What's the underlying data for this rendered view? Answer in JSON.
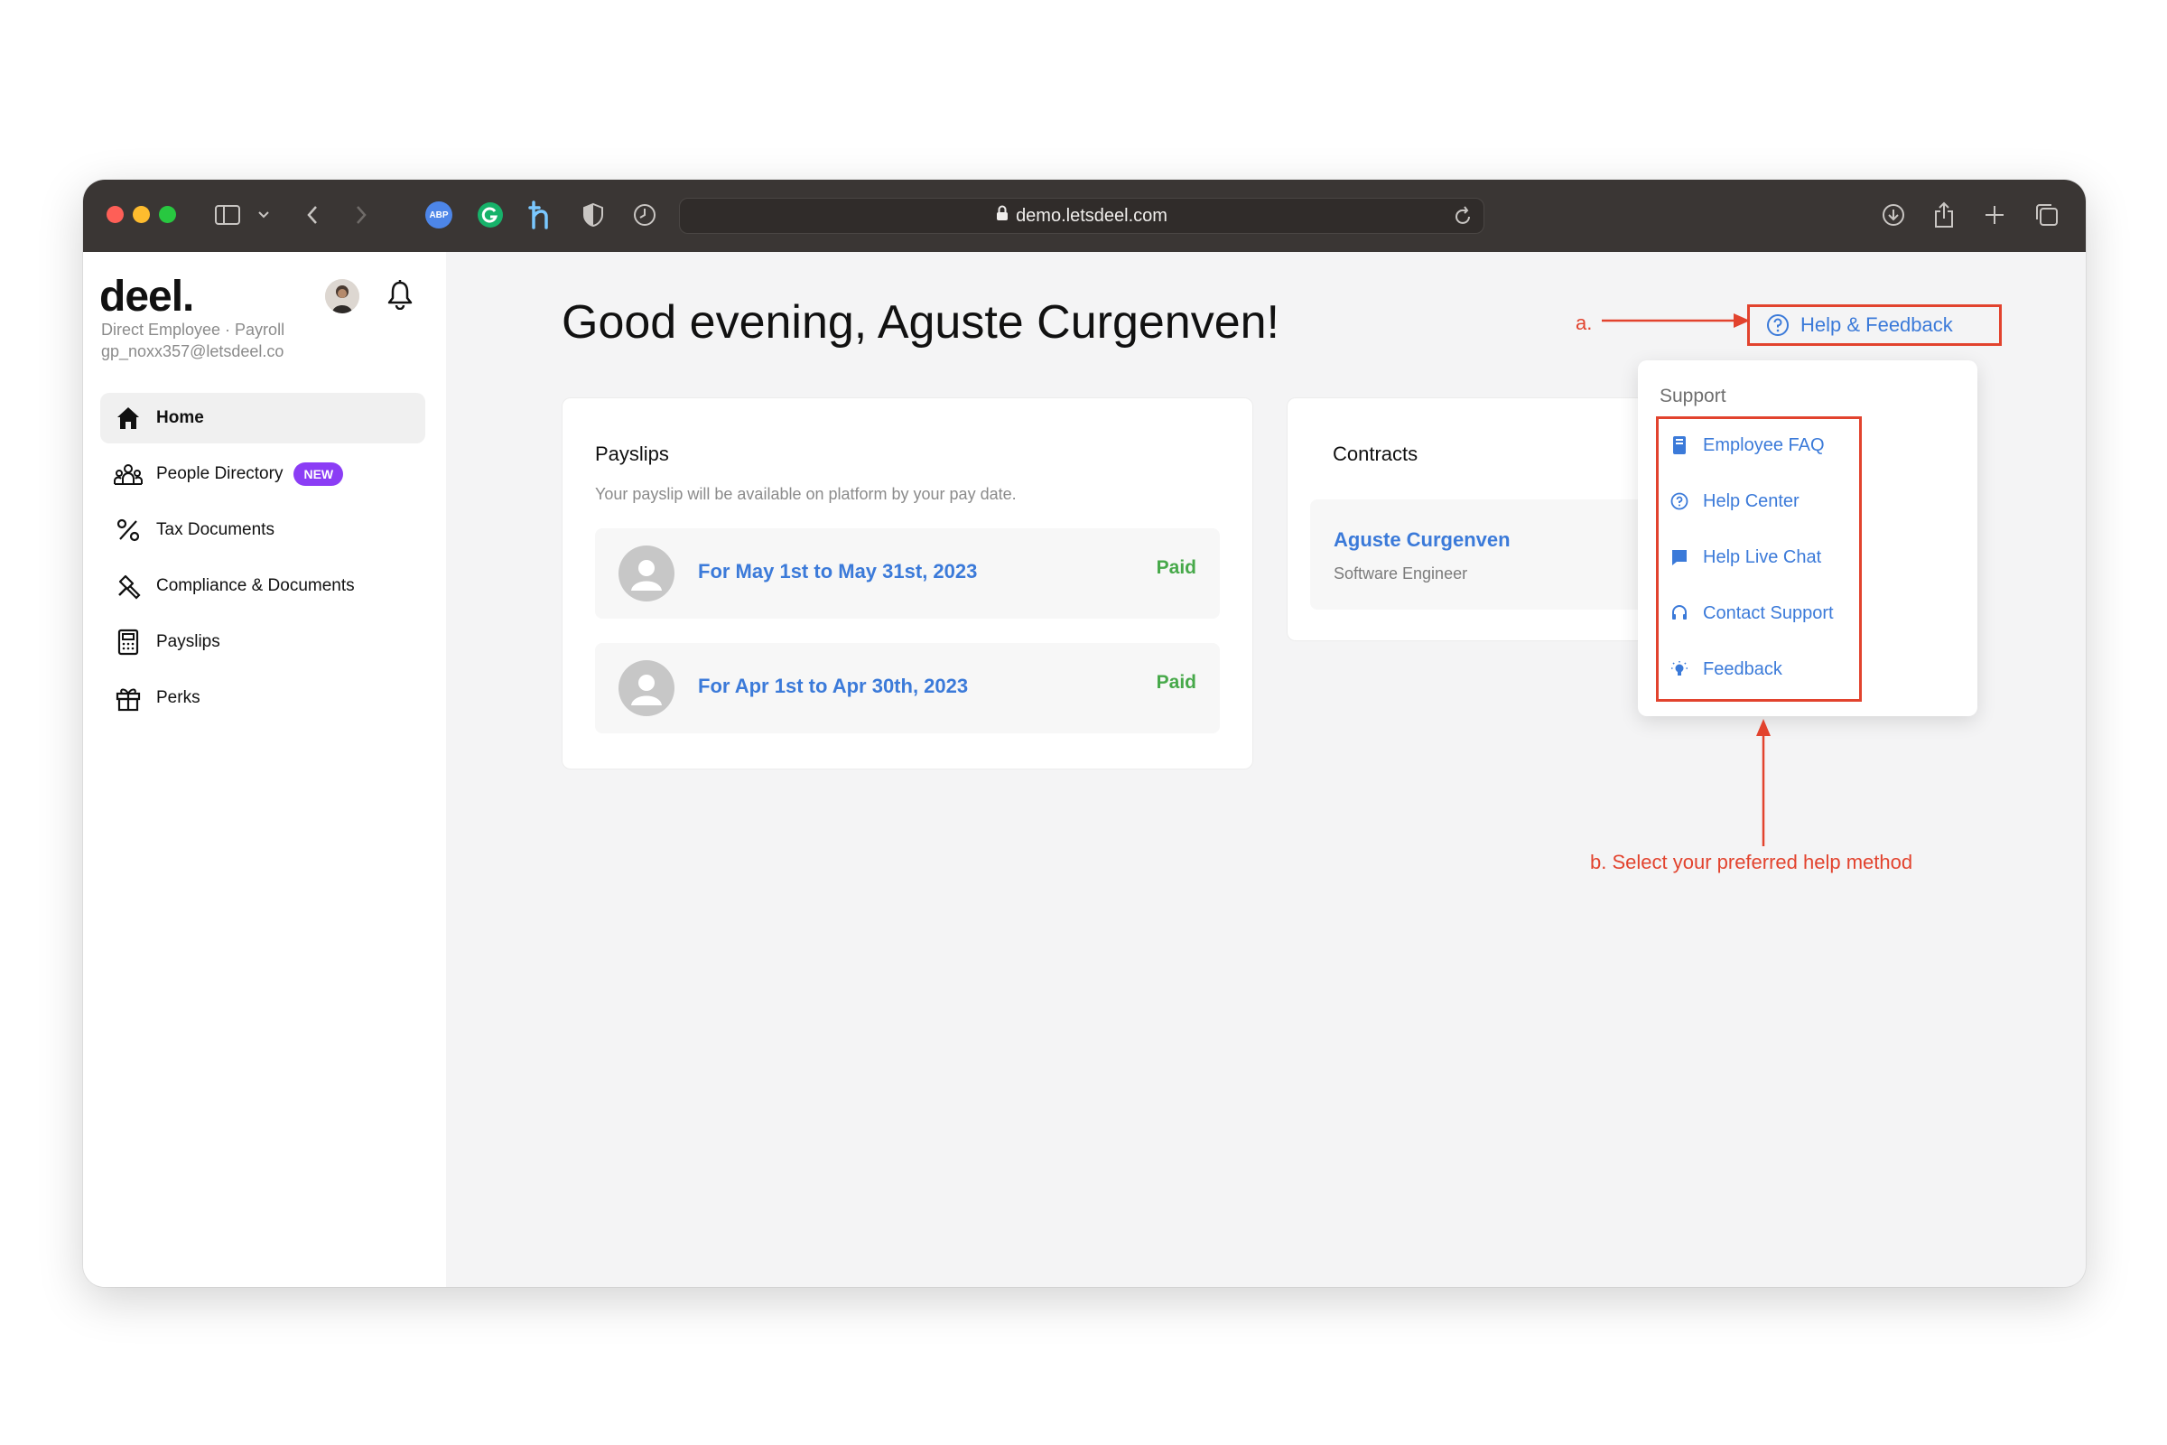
{
  "browser": {
    "url": "demo.letsdeel.com",
    "icons": [
      "sidebar-toggle-icon",
      "chevron-down-icon",
      "back-icon",
      "forward-icon",
      "abp-extension-icon",
      "grammarly-icon",
      "honey-icon",
      "privacy-shield-icon",
      "history-icon",
      "lock-icon",
      "reload-icon",
      "download-icon",
      "share-icon",
      "new-tab-icon",
      "tabs-overview-icon"
    ],
    "abp_label": "ABP"
  },
  "sidebar": {
    "logo": "deel.",
    "user_line_1": "Direct Employee · Payroll",
    "user_line_2": "gp_noxx357@letsdeel.co",
    "items": [
      {
        "label": "Home",
        "icon": "home-icon",
        "active": true
      },
      {
        "label": "People Directory",
        "icon": "people-icon",
        "badge": "NEW"
      },
      {
        "label": "Tax Documents",
        "icon": "percent-icon"
      },
      {
        "label": "Compliance & Documents",
        "icon": "gavel-icon"
      },
      {
        "label": "Payslips",
        "icon": "payslip-icon"
      },
      {
        "label": "Perks",
        "icon": "gift-icon"
      }
    ]
  },
  "main": {
    "greeting": "Good evening, Aguste Curgenven!",
    "payslips": {
      "title": "Payslips",
      "subtitle": "Your payslip will be available on platform by your pay date.",
      "rows": [
        {
          "period": "For May 1st to May 31st, 2023",
          "status": "Paid"
        },
        {
          "period": "For Apr 1st to Apr 30th, 2023",
          "status": "Paid"
        }
      ]
    },
    "contracts": {
      "title": "Contracts",
      "name": "Aguste Curgenven",
      "role": "Software Engineer"
    }
  },
  "help": {
    "button_label": "Help & Feedback",
    "dropdown_title": "Support",
    "items": [
      {
        "label": "Employee FAQ",
        "icon": "book-icon"
      },
      {
        "label": "Help Center",
        "icon": "question-circle-icon"
      },
      {
        "label": "Help Live Chat",
        "icon": "chat-icon"
      },
      {
        "label": "Contact Support",
        "icon": "headset-icon"
      },
      {
        "label": "Feedback",
        "icon": "lightbulb-icon"
      }
    ]
  },
  "annotations": {
    "a": "a.",
    "b": "b. Select your preferred help method"
  },
  "colors": {
    "accent": "#3b7ad9",
    "annotation": "#e2432e",
    "paid": "#47a94a",
    "new_badge": "#8b3df5"
  }
}
